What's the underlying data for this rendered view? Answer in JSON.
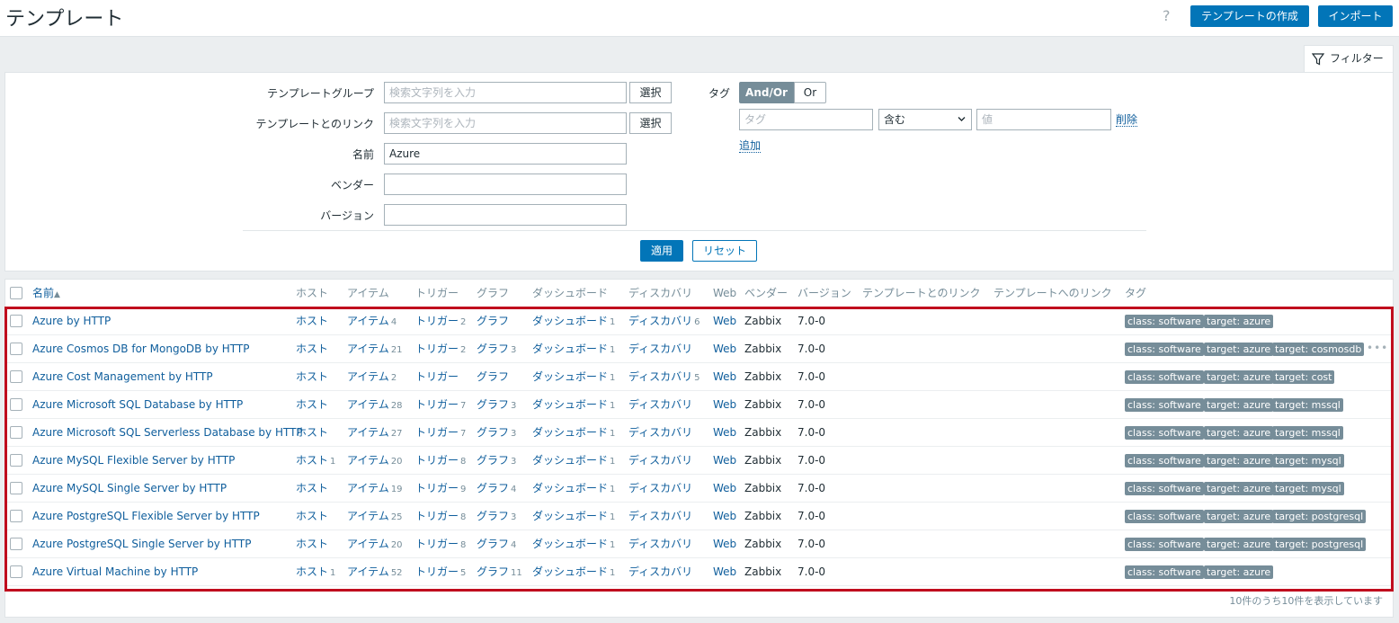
{
  "header": {
    "title": "テンプレート",
    "help": "?",
    "create_label": "テンプレートの作成",
    "import_label": "インポート"
  },
  "filter": {
    "tab_label": "フィルター",
    "fields": {
      "template_group_label": "テンプレートグループ",
      "template_group_placeholder": "検索文字列を入力",
      "linked_label": "テンプレートとのリンク",
      "linked_placeholder": "検索文字列を入力",
      "select_label": "選択",
      "name_label": "名前",
      "name_value": "Azure",
      "vendor_label": "ベンダー",
      "vendor_value": "",
      "version_label": "バージョン",
      "version_value": ""
    },
    "tags": {
      "label": "タグ",
      "and_or": "And/Or",
      "or": "Or",
      "tag_placeholder": "タグ",
      "operator": "含む",
      "value_placeholder": "値",
      "remove": "削除",
      "add": "追加"
    },
    "apply_label": "適用",
    "reset_label": "リセット"
  },
  "table": {
    "columns": {
      "name": "名前",
      "sort_indicator": "▲",
      "hosts": "ホスト",
      "items": "アイテム",
      "triggers": "トリガー",
      "graphs": "グラフ",
      "dashboards": "ダッシュボード",
      "discovery": "ディスカバリ",
      "web": "Web",
      "vendor": "ベンダー",
      "version": "バージョン",
      "linked_templates": "テンプレートとのリンク",
      "linked_to": "テンプレートへのリンク",
      "tags": "タグ"
    },
    "rows": [
      {
        "name": "Azure by HTTP",
        "hosts": "ホスト",
        "hosts_count": "",
        "items": "アイテム",
        "items_count": "4",
        "triggers": "トリガー",
        "triggers_count": "2",
        "graphs": "グラフ",
        "graphs_count": "",
        "dashboards": "ダッシュボード",
        "dashboards_count": "1",
        "discovery": "ディスカバリ",
        "discovery_count": "6",
        "web": "Web",
        "vendor": "Zabbix",
        "version": "7.0-0",
        "tags": [
          "class: software",
          "target: azure"
        ]
      },
      {
        "name": "Azure Cosmos DB for MongoDB by HTTP",
        "hosts": "ホスト",
        "hosts_count": "",
        "items": "アイテム",
        "items_count": "21",
        "triggers": "トリガー",
        "triggers_count": "2",
        "graphs": "グラフ",
        "graphs_count": "3",
        "dashboards": "ダッシュボード",
        "dashboards_count": "1",
        "discovery": "ディスカバリ",
        "discovery_count": "",
        "web": "Web",
        "vendor": "Zabbix",
        "version": "7.0-0",
        "tags": [
          "class: software",
          "target: azure",
          "target: cosmosdb"
        ],
        "more": "•••"
      },
      {
        "name": "Azure Cost Management by HTTP",
        "hosts": "ホスト",
        "hosts_count": "",
        "items": "アイテム",
        "items_count": "2",
        "triggers": "トリガー",
        "triggers_count": "",
        "graphs": "グラフ",
        "graphs_count": "",
        "dashboards": "ダッシュボード",
        "dashboards_count": "1",
        "discovery": "ディスカバリ",
        "discovery_count": "5",
        "web": "Web",
        "vendor": "Zabbix",
        "version": "7.0-0",
        "tags": [
          "class: software",
          "target: azure",
          "target: cost"
        ]
      },
      {
        "name": "Azure Microsoft SQL Database by HTTP",
        "hosts": "ホスト",
        "hosts_count": "",
        "items": "アイテム",
        "items_count": "28",
        "triggers": "トリガー",
        "triggers_count": "7",
        "graphs": "グラフ",
        "graphs_count": "3",
        "dashboards": "ダッシュボード",
        "dashboards_count": "1",
        "discovery": "ディスカバリ",
        "discovery_count": "",
        "web": "Web",
        "vendor": "Zabbix",
        "version": "7.0-0",
        "tags": [
          "class: software",
          "target: azure",
          "target: mssql"
        ]
      },
      {
        "name": "Azure Microsoft SQL Serverless Database by HTTP",
        "hosts": "ホスト",
        "hosts_count": "",
        "items": "アイテム",
        "items_count": "27",
        "triggers": "トリガー",
        "triggers_count": "7",
        "graphs": "グラフ",
        "graphs_count": "3",
        "dashboards": "ダッシュボード",
        "dashboards_count": "1",
        "discovery": "ディスカバリ",
        "discovery_count": "",
        "web": "Web",
        "vendor": "Zabbix",
        "version": "7.0-0",
        "tags": [
          "class: software",
          "target: azure",
          "target: mssql"
        ]
      },
      {
        "name": "Azure MySQL Flexible Server by HTTP",
        "hosts": "ホスト",
        "hosts_count": "1",
        "items": "アイテム",
        "items_count": "20",
        "triggers": "トリガー",
        "triggers_count": "8",
        "graphs": "グラフ",
        "graphs_count": "3",
        "dashboards": "ダッシュボード",
        "dashboards_count": "1",
        "discovery": "ディスカバリ",
        "discovery_count": "",
        "web": "Web",
        "vendor": "Zabbix",
        "version": "7.0-0",
        "tags": [
          "class: software",
          "target: azure",
          "target: mysql"
        ]
      },
      {
        "name": "Azure MySQL Single Server by HTTP",
        "hosts": "ホスト",
        "hosts_count": "",
        "items": "アイテム",
        "items_count": "19",
        "triggers": "トリガー",
        "triggers_count": "9",
        "graphs": "グラフ",
        "graphs_count": "4",
        "dashboards": "ダッシュボード",
        "dashboards_count": "1",
        "discovery": "ディスカバリ",
        "discovery_count": "",
        "web": "Web",
        "vendor": "Zabbix",
        "version": "7.0-0",
        "tags": [
          "class: software",
          "target: azure",
          "target: mysql"
        ]
      },
      {
        "name": "Azure PostgreSQL Flexible Server by HTTP",
        "hosts": "ホスト",
        "hosts_count": "",
        "items": "アイテム",
        "items_count": "25",
        "triggers": "トリガー",
        "triggers_count": "8",
        "graphs": "グラフ",
        "graphs_count": "3",
        "dashboards": "ダッシュボード",
        "dashboards_count": "1",
        "discovery": "ディスカバリ",
        "discovery_count": "",
        "web": "Web",
        "vendor": "Zabbix",
        "version": "7.0-0",
        "tags": [
          "class: software",
          "target: azure",
          "target: postgresql"
        ]
      },
      {
        "name": "Azure PostgreSQL Single Server by HTTP",
        "hosts": "ホスト",
        "hosts_count": "",
        "items": "アイテム",
        "items_count": "20",
        "triggers": "トリガー",
        "triggers_count": "8",
        "graphs": "グラフ",
        "graphs_count": "4",
        "dashboards": "ダッシュボード",
        "dashboards_count": "1",
        "discovery": "ディスカバリ",
        "discovery_count": "",
        "web": "Web",
        "vendor": "Zabbix",
        "version": "7.0-0",
        "tags": [
          "class: software",
          "target: azure",
          "target: postgresql"
        ]
      },
      {
        "name": "Azure Virtual Machine by HTTP",
        "hosts": "ホスト",
        "hosts_count": "1",
        "items": "アイテム",
        "items_count": "52",
        "triggers": "トリガー",
        "triggers_count": "5",
        "graphs": "グラフ",
        "graphs_count": "11",
        "dashboards": "ダッシュボード",
        "dashboards_count": "1",
        "discovery": "ディスカバリ",
        "discovery_count": "",
        "web": "Web",
        "vendor": "Zabbix",
        "version": "7.0-0",
        "tags": [
          "class: software",
          "target: azure"
        ]
      }
    ],
    "footer": "10件のうち10件を表示しています"
  },
  "colors": {
    "primary": "#0275b8",
    "link": "#0f5e9c",
    "tag_bg": "#768d99",
    "highlight_border": "#c00d1e"
  }
}
